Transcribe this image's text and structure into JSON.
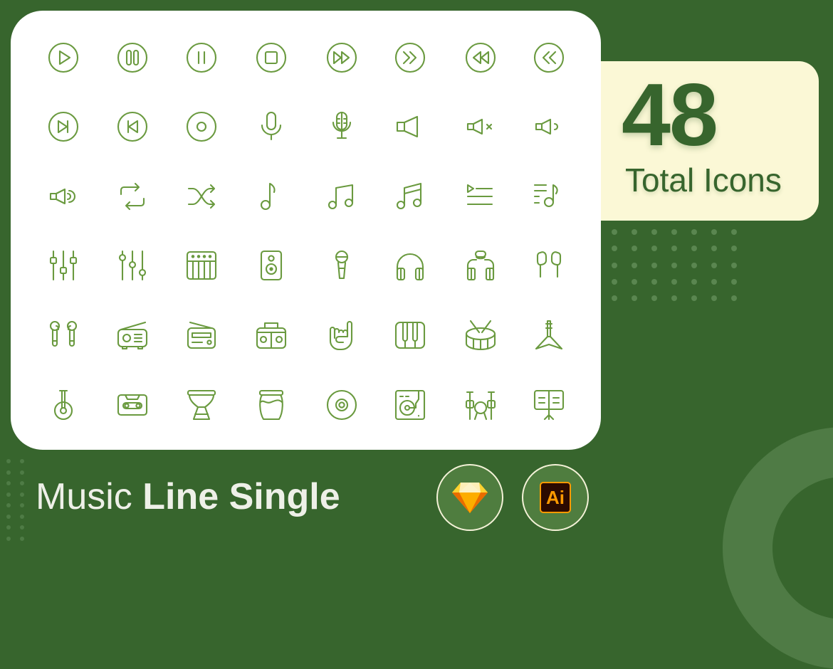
{
  "title": {
    "regular": "Music ",
    "bold": "Line Single"
  },
  "stats": {
    "count": "48",
    "label": "Total Icons"
  },
  "colors": {
    "background": "#37652d",
    "card": "#ffffff",
    "icon_stroke": "#6a9a3f",
    "panel": "#fbf8d6",
    "accent_text": "#37652d"
  },
  "tools": [
    {
      "name": "sketch",
      "label": ""
    },
    {
      "name": "illustrator",
      "label": "Ai"
    }
  ],
  "icons": [
    "play-circle-icon",
    "pause-circle-icon",
    "pause-thin-circle-icon",
    "stop-circle-icon",
    "fast-forward-circle-icon",
    "chevrons-forward-circle-icon",
    "rewind-circle-icon",
    "chevrons-back-circle-icon",
    "skip-next-circle-icon",
    "skip-previous-circle-icon",
    "record-circle-icon",
    "microphone-icon",
    "studio-microphone-icon",
    "speaker-icon",
    "speaker-mute-icon",
    "speaker-low-icon",
    "speaker-high-icon",
    "repeat-icon",
    "shuffle-icon",
    "music-note-icon",
    "music-notes-icon",
    "beamed-notes-icon",
    "playlist-icon",
    "music-queue-icon",
    "equalizer-square-icon",
    "equalizer-round-icon",
    "synthesizer-icon",
    "loudspeaker-icon",
    "handheld-mic-icon",
    "headphones-icon",
    "headset-icon",
    "earphones-icon",
    "earbuds-icon",
    "radio-icon",
    "retro-radio-icon",
    "boombox-icon",
    "rock-hand-icon",
    "piano-keys-icon",
    "snare-drum-icon",
    "electric-guitar-icon",
    "banjo-icon",
    "cassette-icon",
    "djembe-icon",
    "jar-drum-icon",
    "vinyl-disc-icon",
    "turntable-icon",
    "drum-kit-icon",
    "music-stand-icon"
  ]
}
